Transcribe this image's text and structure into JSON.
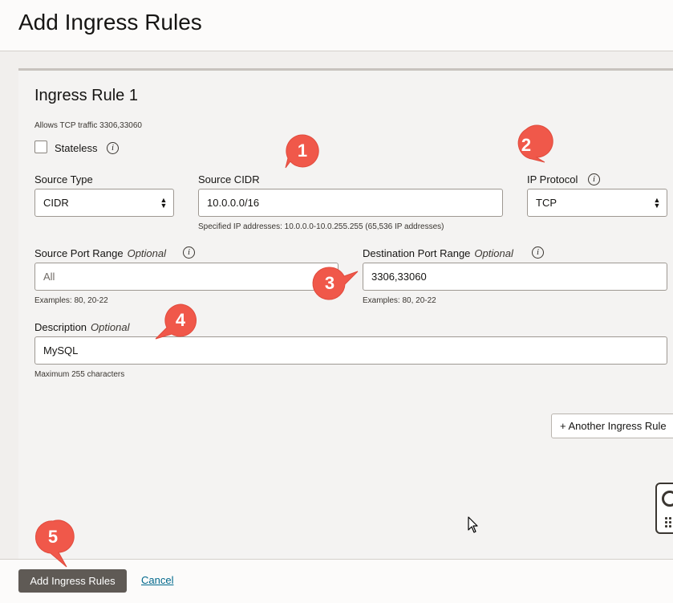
{
  "dialog": {
    "title": "Add Ingress Rules"
  },
  "rule": {
    "title": "Ingress Rule 1",
    "subtitle": "Allows TCP traffic 3306,33060",
    "stateless_label": "Stateless",
    "info_glyph": "i"
  },
  "source_type": {
    "label": "Source Type",
    "value": "CIDR"
  },
  "source_cidr": {
    "label": "Source CIDR",
    "value": "10.0.0.0/16",
    "help": "Specified IP addresses: 10.0.0.0-10.0.255.255 (65,536 IP addresses)"
  },
  "ip_protocol": {
    "label": "IP Protocol",
    "value": "TCP"
  },
  "source_port": {
    "label": "Source Port Range",
    "optional": "Optional",
    "placeholder": "All",
    "help": "Examples: 80, 20-22"
  },
  "destination_port": {
    "label": "Destination Port Range",
    "optional": "Optional",
    "value": "3306,33060",
    "help": "Examples: 80, 20-22"
  },
  "description": {
    "label": "Description",
    "optional": "Optional",
    "value": "MySQL",
    "help": "Maximum 255 characters"
  },
  "another_rule_button": "+ Another Ingress Rule",
  "footer": {
    "primary": "Add Ingress Rules",
    "cancel": "Cancel"
  },
  "markers": [
    "1",
    "2",
    "3",
    "4",
    "5"
  ],
  "colors": {
    "marker": "#f0584a",
    "primary_button": "#5f5a55",
    "link": "#00688c"
  },
  "icons": [
    "info-icon",
    "select-chevron-icon",
    "help-lifebuoy-icon",
    "mouse-cursor-icon"
  ]
}
